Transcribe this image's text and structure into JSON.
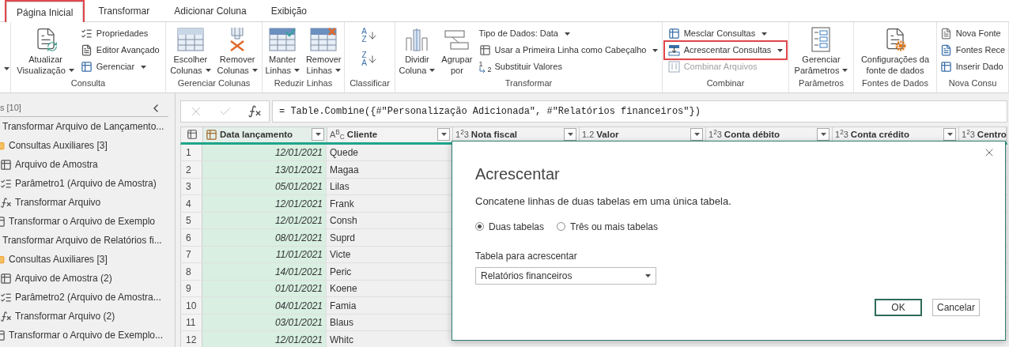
{
  "tabs": [
    {
      "label": "Página Inicial",
      "selected": true,
      "highlighted": true
    },
    {
      "label": "Transformar",
      "selected": false,
      "highlighted": false
    },
    {
      "label": "Adicionar Coluna",
      "selected": false,
      "highlighted": false
    },
    {
      "label": "Exibição",
      "selected": false,
      "highlighted": false
    }
  ],
  "ribbon": {
    "groups": [
      {
        "items": [
          {
            "kind": "partial",
            "dropdown": true
          }
        ]
      },
      {
        "label": "Consulta",
        "items": [
          {
            "kind": "large",
            "lines": [
              "Atualizar",
              "Visualização"
            ],
            "dropdown": true
          },
          {
            "kind": "stack",
            "buttons": [
              {
                "label": "Propriedades",
                "dropdown": false
              },
              {
                "label": "Editor Avançado",
                "dropdown": false
              },
              {
                "label": "Gerenciar",
                "dropdown": true
              }
            ]
          }
        ]
      },
      {
        "label": "Gerenciar Colunas",
        "items": [
          {
            "kind": "large",
            "lines": [
              "Escolher",
              "Colunas"
            ],
            "dropdown": true
          },
          {
            "kind": "large",
            "lines": [
              "Remover",
              "Colunas"
            ],
            "dropdown": true
          }
        ]
      },
      {
        "label": "Reduzir Linhas",
        "items": [
          {
            "kind": "large",
            "lines": [
              "Manter",
              "Linhas"
            ],
            "dropdown": true
          },
          {
            "kind": "large",
            "lines": [
              "Remover",
              "Linhas"
            ],
            "dropdown": true
          }
        ]
      },
      {
        "label": "Classificar",
        "items": [
          {
            "kind": "sort",
            "buttons": [
              {
                "top": "A",
                "bottom": "Z"
              },
              {
                "top": "Z",
                "bottom": "A"
              }
            ]
          }
        ]
      },
      {
        "label": "Transformar",
        "items": [
          {
            "kind": "large",
            "lines": [
              "Dividir",
              "Coluna"
            ],
            "dropdown": true
          },
          {
            "kind": "large",
            "lines": [
              "Agrupar",
              "por"
            ],
            "dropdown": false
          },
          {
            "kind": "stack",
            "buttons": [
              {
                "label": "Tipo de Dados: Data",
                "dropdown": true
              },
              {
                "label": "Usar a Primeira Linha como Cabeçalho",
                "dropdown": true
              },
              {
                "label": "Substituir Valores",
                "dropdown": false,
                "glyphs": [
                  "1",
                  "2"
                ]
              }
            ]
          }
        ]
      },
      {
        "label": "Combinar",
        "items": [
          {
            "kind": "stack",
            "buttons": [
              {
                "label": "Mesclar Consultas",
                "dropdown": true,
                "highlighted": false,
                "disabled": false
              },
              {
                "label": "Acrescentar Consultas",
                "dropdown": true,
                "highlighted": true,
                "disabled": false
              },
              {
                "label": "Combinar Arquivos",
                "dropdown": false,
                "highlighted": false,
                "disabled": true
              }
            ]
          }
        ]
      },
      {
        "label": "Parâmetros",
        "items": [
          {
            "kind": "large",
            "lines": [
              "Gerenciar",
              "Parâmetros"
            ],
            "dropdown": true
          }
        ]
      },
      {
        "label": "Fontes de Dados",
        "items": [
          {
            "kind": "large",
            "lines": [
              "Configurações da",
              "fonte de dados"
            ],
            "dropdown": false
          }
        ]
      },
      {
        "label": "Nova Consu",
        "items": [
          {
            "kind": "stack",
            "buttons": [
              {
                "label": "Nova Fonte",
                "dropdown": false
              },
              {
                "label": "Fontes Rece",
                "dropdown": false
              },
              {
                "label": "Inserir Dado",
                "dropdown": false
              }
            ]
          }
        ]
      }
    ]
  },
  "queries": {
    "header": "s [10]",
    "items": [
      {
        "label": "Transformar Arquivo de Lançamento...",
        "children": [
          {
            "kind": "folder",
            "label": "Consultas Auxiliares [3]",
            "children": [
              {
                "kind": "table",
                "label": "Arquivo de Amostra"
              },
              {
                "kind": "parameter",
                "label": "Parâmetro1 (Arquivo de Amostra)"
              },
              {
                "kind": "function",
                "label": "Transformar Arquivo"
              }
            ]
          },
          {
            "kind": "table",
            "label": "Transformar o Arquivo de Exemplo"
          }
        ]
      },
      {
        "label": "Transformar Arquivo de Relatórios fi...",
        "children": [
          {
            "kind": "folder",
            "label": "Consultas Auxiliares [3]",
            "children": [
              {
                "kind": "table",
                "label": "Arquivo de Amostra (2)"
              },
              {
                "kind": "parameter",
                "label": "Parâmetro2 (Arquivo de Amostra..."
              },
              {
                "kind": "function",
                "label": "Transformar Arquivo (2)"
              }
            ]
          },
          {
            "kind": "table",
            "label": "Transformar o Arquivo de Exemplo..."
          }
        ]
      }
    ]
  },
  "formula_bar": {
    "formula": "= Table.Combine({#\"Personalização Adicionada\", #\"Relatórios financeiros\"})"
  },
  "table": {
    "columns": [
      {
        "name": "Data lançamento",
        "kind": "date",
        "selected": true
      },
      {
        "name": "Cliente",
        "kind": "typed",
        "type_label": "A$^{B}$$_{C}$",
        "selected": false
      },
      {
        "name": "Nota fiscal",
        "kind": "typed",
        "type_label": "1$^{2}$3",
        "selected": false
      },
      {
        "name": "Valor",
        "kind": "typed",
        "type_label": "1.2",
        "selected": false
      },
      {
        "name": "Conta débito",
        "kind": "typed",
        "type_label": "1$^{2}$3",
        "selected": false
      },
      {
        "name": "Conta crédito",
        "kind": "typed",
        "type_label": "1$^{2}$3",
        "selected": false
      },
      {
        "name": "Centro",
        "kind": "typed",
        "type_label": "1$^{2}$3",
        "selected": false
      }
    ],
    "rows": [
      {
        "number": "1",
        "cells": [
          "12/01/2021",
          "Quede"
        ]
      },
      {
        "number": "2",
        "cells": [
          "13/01/2021",
          "Magaa"
        ]
      },
      {
        "number": "3",
        "cells": [
          "05/01/2021",
          "Lilas"
        ]
      },
      {
        "number": "4",
        "cells": [
          "12/01/2021",
          "Frank"
        ]
      },
      {
        "number": "5",
        "cells": [
          "12/01/2021",
          "Consh"
        ]
      },
      {
        "number": "6",
        "cells": [
          "08/01/2021",
          "Suprd"
        ]
      },
      {
        "number": "7",
        "cells": [
          "11/01/2021",
          "Victe"
        ]
      },
      {
        "number": "8",
        "cells": [
          "14/01/2021",
          "Peric"
        ]
      },
      {
        "number": "9",
        "cells": [
          "01/01/2021",
          "Koene"
        ]
      },
      {
        "number": "10",
        "cells": [
          "04/01/2021",
          "Famia"
        ]
      },
      {
        "number": "11",
        "cells": [
          "03/01/2021",
          "Blaus"
        ]
      },
      {
        "number": "12",
        "cells": [
          "12/01/2021",
          "Whitc"
        ]
      }
    ]
  },
  "dialog": {
    "title": "Acrescentar",
    "description": "Concatene linhas de duas tabelas em uma única tabela.",
    "options": [
      {
        "label": "Duas tabelas",
        "selected": true
      },
      {
        "label": "Três ou mais tabelas",
        "selected": false
      }
    ],
    "field_label": "Tabela para acrescentar",
    "field_value": "Relatórios financeiros",
    "buttons": [
      {
        "label": "OK",
        "kind": "primary"
      },
      {
        "label": "Cancelar",
        "kind": "secondary"
      }
    ]
  }
}
